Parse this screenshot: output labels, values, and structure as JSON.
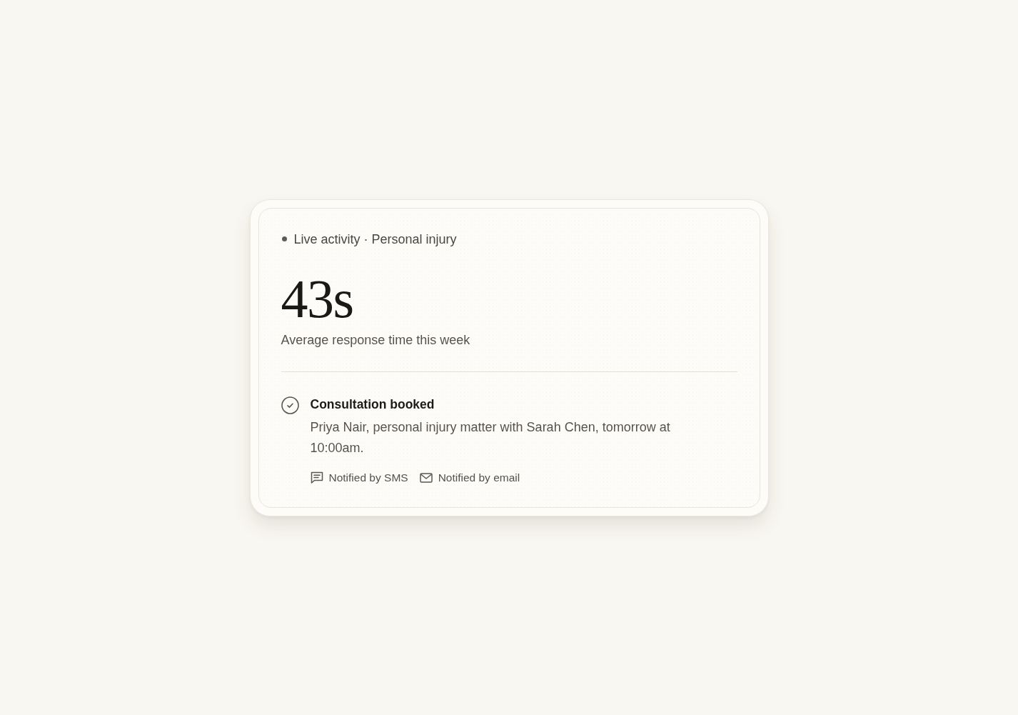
{
  "card": {
    "header": {
      "label": "Live activity · Personal injury"
    },
    "metric": {
      "value": "43s",
      "caption": "Average response time this week"
    },
    "events": [
      {
        "kind": "booked",
        "title": "Consultation booked",
        "description": "Priya Nair, personal injury matter with Sarah Chen, tomorrow at 10:00am.",
        "notifications": [
          {
            "kind": "sms",
            "label": "Notified by SMS"
          },
          {
            "kind": "email",
            "label": "Notified by email"
          }
        ]
      }
    ]
  }
}
